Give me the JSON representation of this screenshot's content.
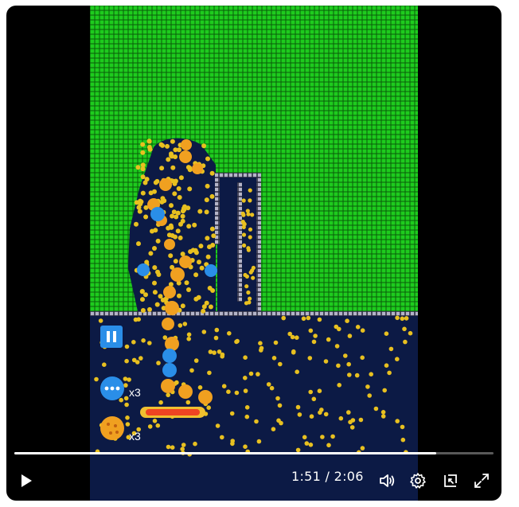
{
  "player": {
    "current_time": "1:51",
    "separator": " / ",
    "duration": "2:06",
    "progress": 0.88,
    "colors": {
      "frame_bg": "#000000",
      "controls_text": "#ffffff"
    }
  },
  "game": {
    "ball_multiplier_label": "x3",
    "bomb_multiplier_label": "x3",
    "colors": {
      "brick": "#1ecb1e",
      "brick_gap": "#0a5c0a",
      "field": "#0c1a45",
      "ball": "#e8c020",
      "wall": "#b4b4c8",
      "powerup_blue": "#2a8ee8",
      "paddle": "#ee4422"
    }
  },
  "controls": {
    "play_icon": "play-icon",
    "volume_icon": "volume-icon",
    "settings_icon": "gear-icon",
    "miniplayer_icon": "miniplayer-icon",
    "fullscreen_icon": "fullscreen-icon"
  }
}
